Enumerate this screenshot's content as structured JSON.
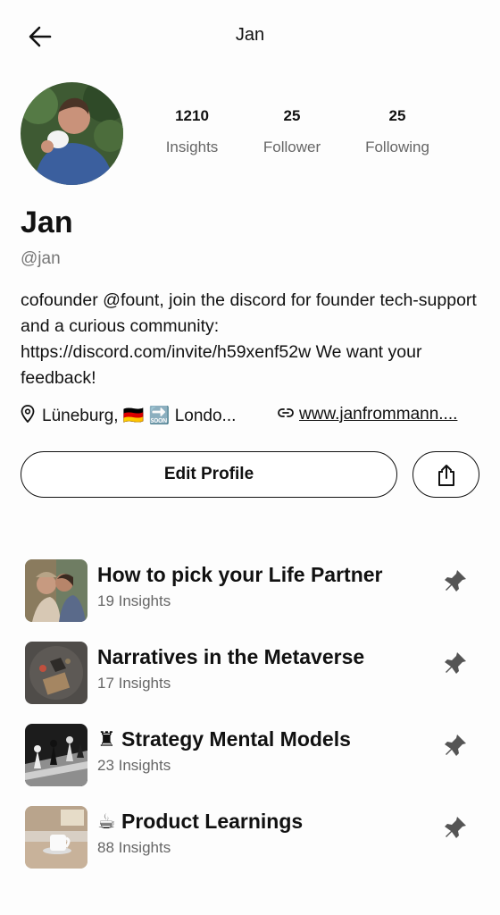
{
  "header": {
    "title": "Jan",
    "back_icon": "arrow-left-icon"
  },
  "profile": {
    "name": "Jan",
    "handle": "@jan",
    "bio": "cofounder @fount, join the discord for founder tech-support and a curious community: https://discord.com/invite/h59xenf52w We want your feedback!",
    "location": "Lüneburg, 🇩🇪 🔜 Londo...",
    "website": "www.janfrommann....",
    "stats": [
      {
        "value": "1210",
        "label": "Insights"
      },
      {
        "value": "25",
        "label": "Follower"
      },
      {
        "value": "25",
        "label": "Following"
      }
    ]
  },
  "actions": {
    "edit_label": "Edit Profile",
    "share_icon": "share-icon"
  },
  "collections": [
    {
      "title": "How to pick your Life Partner",
      "count": "19 Insights"
    },
    {
      "title": "Narratives in the Metaverse",
      "count": "17 Insights"
    },
    {
      "title": "♜ Strategy Mental Models",
      "count": "23 Insights"
    },
    {
      "title": "☕ Product Learnings",
      "count": "88 Insights"
    }
  ],
  "colors": {
    "text": "#111111",
    "muted": "#666666",
    "background": "#fdfdfd"
  }
}
